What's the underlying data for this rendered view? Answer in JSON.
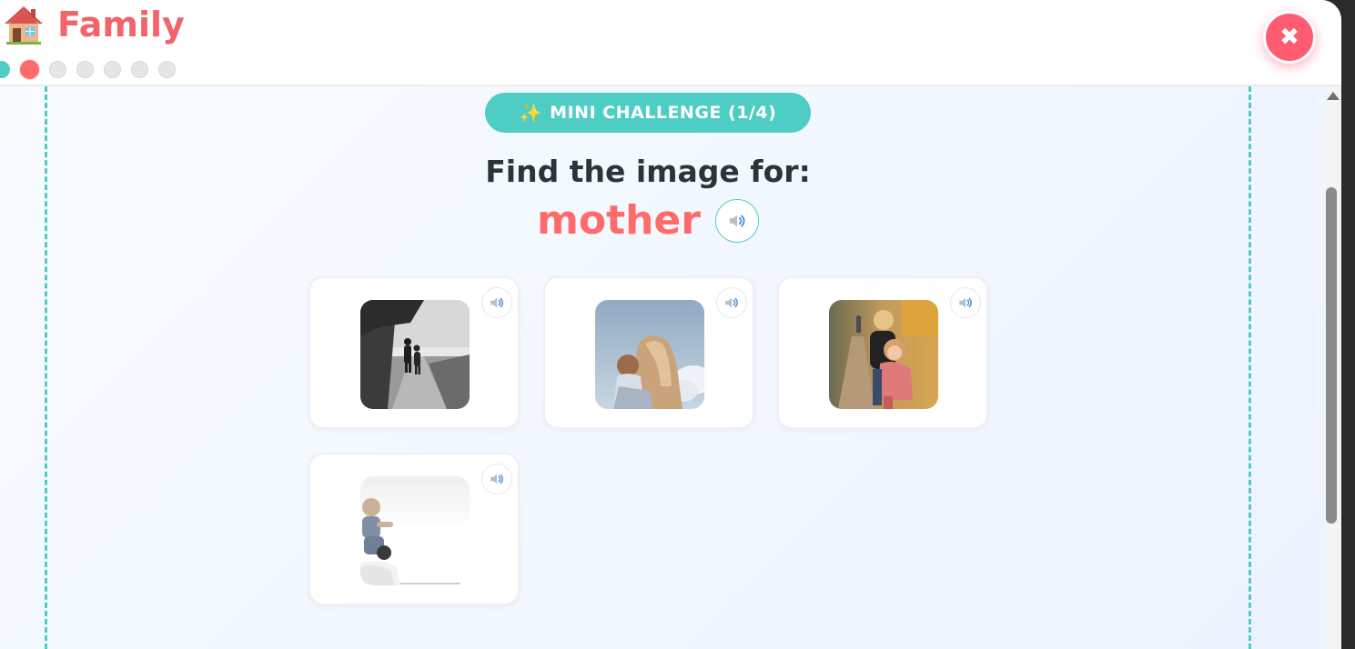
{
  "header": {
    "title": "Family",
    "icon": "house-icon",
    "progress": {
      "total_dots": 7,
      "completed": 1,
      "current_index": 1
    },
    "close_label": "✖"
  },
  "challenge": {
    "badge": "MINI CHALLENGE (1/4)",
    "badge_icon": "✨",
    "prompt": "Find the image for:",
    "target_word": "mother"
  },
  "options": [
    {
      "name": "option-children-walking-beach",
      "icon": "speaker-icon"
    },
    {
      "name": "option-mother-hugging-child",
      "icon": "speaker-icon"
    },
    {
      "name": "option-siblings-hugging",
      "icon": "speaker-icon"
    },
    {
      "name": "option-child-on-shoulders",
      "icon": "speaker-icon"
    }
  ],
  "colors": {
    "accent": "#4ecdc4",
    "primary": "#ff6b6b",
    "close": "#ff5c72",
    "text": "#2d3436"
  }
}
